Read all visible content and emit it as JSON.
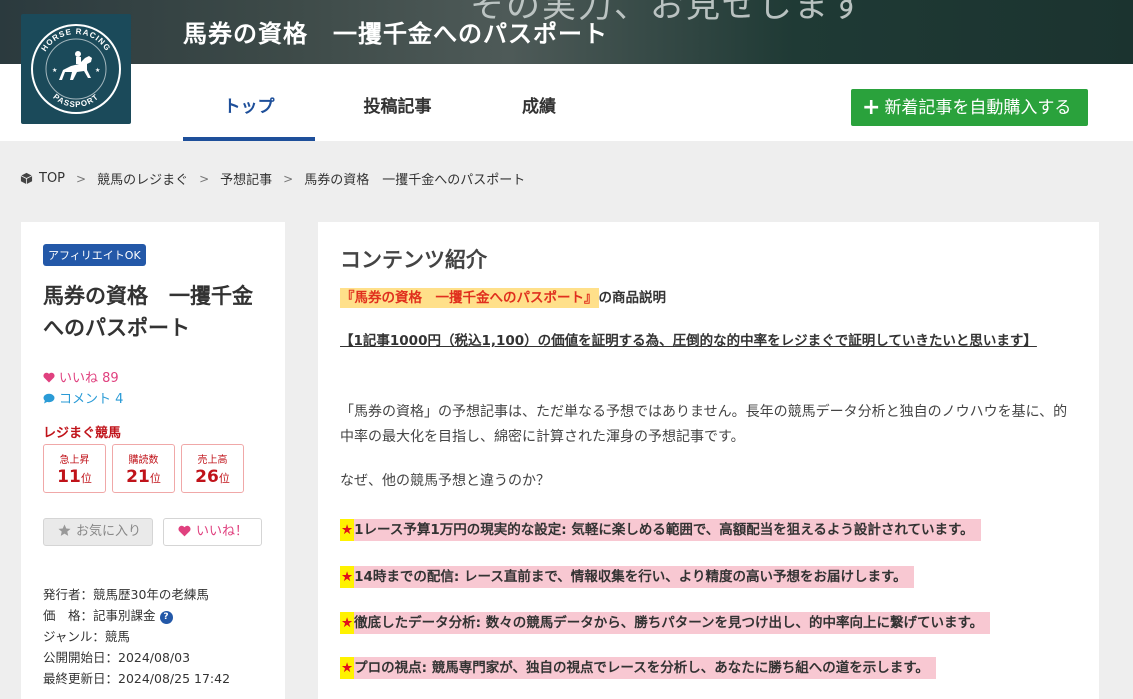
{
  "header": {
    "banner_bg_text": "その実力、お見せします",
    "site_title": "馬券の資格　一攫千金へのパスポート",
    "logo_text_top": "HORSE RACING",
    "logo_text_bottom": "PASSPORT"
  },
  "nav": {
    "tabs": [
      {
        "label": "トップ"
      },
      {
        "label": "投稿記事"
      },
      {
        "label": "成績"
      }
    ],
    "buy_button_plus": "+",
    "buy_button_label": "新着記事を自動購入する"
  },
  "breadcrumb": {
    "separator": ">",
    "items": [
      "TOP",
      "競馬のレジまぐ",
      "予想記事",
      "馬券の資格　一攫千金へのパスポート"
    ]
  },
  "sidebar": {
    "badge": "アフィリエイトOK",
    "title": "馬券の資格　一攫千金へのパスポート",
    "likes_label": "いいね 89",
    "comments_label": "コメント 4",
    "ranking_title": "レジまぐ競馬",
    "rankings": [
      {
        "label": "急上昇",
        "rank": "11",
        "unit": "位"
      },
      {
        "label": "購読数",
        "rank": "21",
        "unit": "位"
      },
      {
        "label": "売上高",
        "rank": "26",
        "unit": "位"
      }
    ],
    "favorite_button": "お気に入り",
    "like_button": "いいね！",
    "meta": {
      "publisher": "発行者：競馬歴30年の老練馬",
      "price": "価　格：記事別課金",
      "genre": "ジャンル：競馬",
      "start_date": "公開開始日：2024/08/03",
      "updated": "最終更新日：2024/08/25 17:42"
    },
    "help_icon_glyph": "?"
  },
  "main": {
    "heading": "コンテンツ紹介",
    "intro_highlight": "『馬券の資格　一攫千金へのパスポート』",
    "intro_rest": "の商品説明",
    "claim": "【1記事1000円（税込1,100）の価値を証明する為、圧倒的な的中率をレジまぐで証明していきたいと思います】",
    "paragraph1": "「馬券の資格」の予想記事は、ただ単なる予想ではありません。長年の競馬データ分析と独自のノウハウを基に、的中率の最大化を目指し、綿密に計算された渾身の予想記事です。",
    "paragraph2": "なぜ、他の競馬予想と違うのか？",
    "star": "★",
    "points": [
      "1レース予算1万円の現実的な設定: 気軽に楽しめる範囲で、高額配当を狙えるよう設計されています。",
      "14時までの配信: レース直前まで、情報収集を行い、より精度の高い予想をお届けします。",
      "徹底したデータ分析: 数々の競馬データから、勝ちパターンを見つけ出し、的中率向上に繋げています。",
      "プロの視点: 競馬専門家が、独自の視点でレースを分析し、あなたに勝ち組への道を示します。"
    ]
  },
  "colors": {
    "nav_active": "#1e4f9a",
    "buy_button": "#2aa23c",
    "badge": "#2358a8",
    "rank_red": "#c0131a",
    "like_pink": "#e0417f",
    "comment_blue": "#2a9bd6",
    "point_bg": "#f8c8d2",
    "star_bg": "#fff200"
  }
}
